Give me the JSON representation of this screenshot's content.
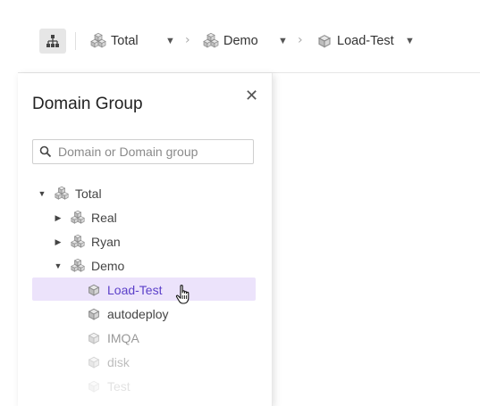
{
  "breadcrumb": {
    "items": [
      {
        "label": "Total",
        "icon": "domain-group-icon"
      },
      {
        "label": "Demo",
        "icon": "domain-group-icon"
      },
      {
        "label": "Load-Test",
        "icon": "domain-icon"
      }
    ]
  },
  "panel": {
    "title": "Domain Group",
    "search_placeholder": "Domain or Domain group",
    "tree": [
      {
        "label": "Total",
        "expanded": true,
        "icon": "domain-group-icon"
      },
      {
        "label": "Real",
        "expanded": false,
        "icon": "domain-group-icon"
      },
      {
        "label": "Ryan",
        "expanded": false,
        "icon": "domain-group-icon"
      },
      {
        "label": "Demo",
        "expanded": true,
        "icon": "domain-group-icon"
      },
      {
        "label": "Load-Test",
        "selected": true,
        "icon": "domain-icon"
      },
      {
        "label": "autodeploy",
        "icon": "domain-icon"
      },
      {
        "label": "IMQA",
        "icon": "domain-icon"
      },
      {
        "label": "disk",
        "icon": "domain-icon"
      },
      {
        "label": "Test",
        "icon": "domain-icon"
      }
    ]
  },
  "colors": {
    "accent": "#5b3fc9",
    "selected_bg": "#ece3fb",
    "toolbar_button_bg": "#e6e6e6"
  }
}
